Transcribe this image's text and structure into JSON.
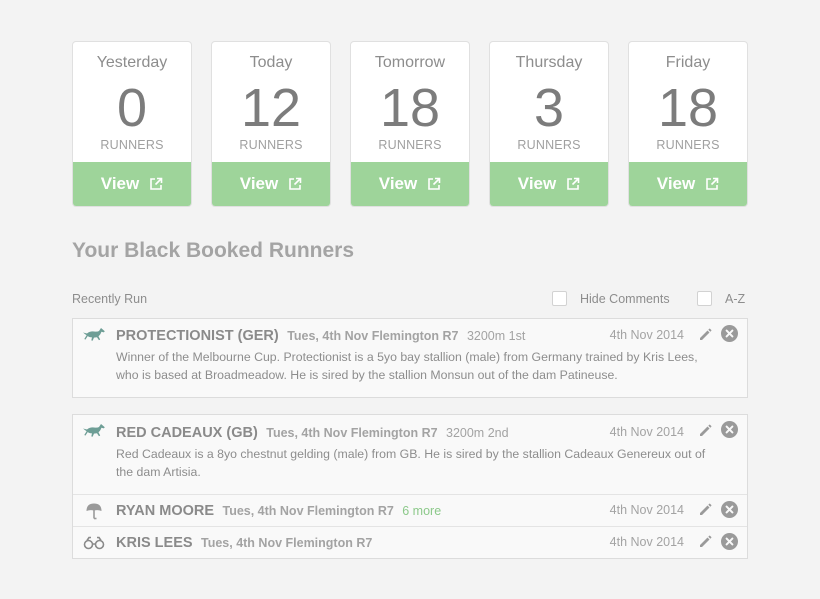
{
  "cards": [
    {
      "day": "Yesterday",
      "count": "0",
      "unit": "RUNNERS",
      "view_label": "View"
    },
    {
      "day": "Today",
      "count": "12",
      "unit": "RUNNERS",
      "view_label": "View"
    },
    {
      "day": "Tomorrow",
      "count": "18",
      "unit": "RUNNERS",
      "view_label": "View"
    },
    {
      "day": "Thursday",
      "count": "3",
      "unit": "RUNNERS",
      "view_label": "View"
    },
    {
      "day": "Friday",
      "count": "18",
      "unit": "RUNNERS",
      "view_label": "View"
    }
  ],
  "section_title": "Your Black Booked Runners",
  "filters": {
    "recently_run": "Recently Run",
    "hide_comments": "Hide Comments",
    "az": "A-Z"
  },
  "groups": [
    {
      "rows": [
        {
          "icon": "horse-icon",
          "name": "PROTECTIONIST (GER)",
          "meta": "Tues, 4th Nov Flemington R7",
          "extra": "3200m 1st",
          "date": "4th Nov 2014",
          "comment": "Winner of the Melbourne Cup. Protectionist is a 5yo bay stallion (male) from Germany trained by Kris Lees, who is based at Broadmeadow. He is sired by the stallion Monsun out of the dam Patineuse."
        }
      ]
    },
    {
      "rows": [
        {
          "icon": "horse-icon",
          "name": "RED CADEAUX (GB)",
          "meta": "Tues, 4th Nov Flemington R7",
          "extra": "3200m 2nd",
          "date": "4th Nov 2014",
          "comment": "Red Cadeaux is a 8yo chestnut gelding (male) from GB. He is sired by the stallion Cadeaux Genereux out of the dam Artisia."
        },
        {
          "icon": "jockey-helmet-icon",
          "name": "RYAN MOORE",
          "meta": "Tues, 4th Nov Flemington R7",
          "more": "6 more",
          "date": "4th Nov 2014"
        },
        {
          "icon": "binoculars-icon",
          "name": "KRIS LEES",
          "meta": "Tues, 4th Nov Flemington R7",
          "date": "4th Nov 2014"
        }
      ]
    }
  ],
  "colors": {
    "accent_green": "#9ed49a",
    "more_link_green": "#8cc98a",
    "background": "#f3f3f3",
    "horse_icon": "#6e9e96"
  }
}
